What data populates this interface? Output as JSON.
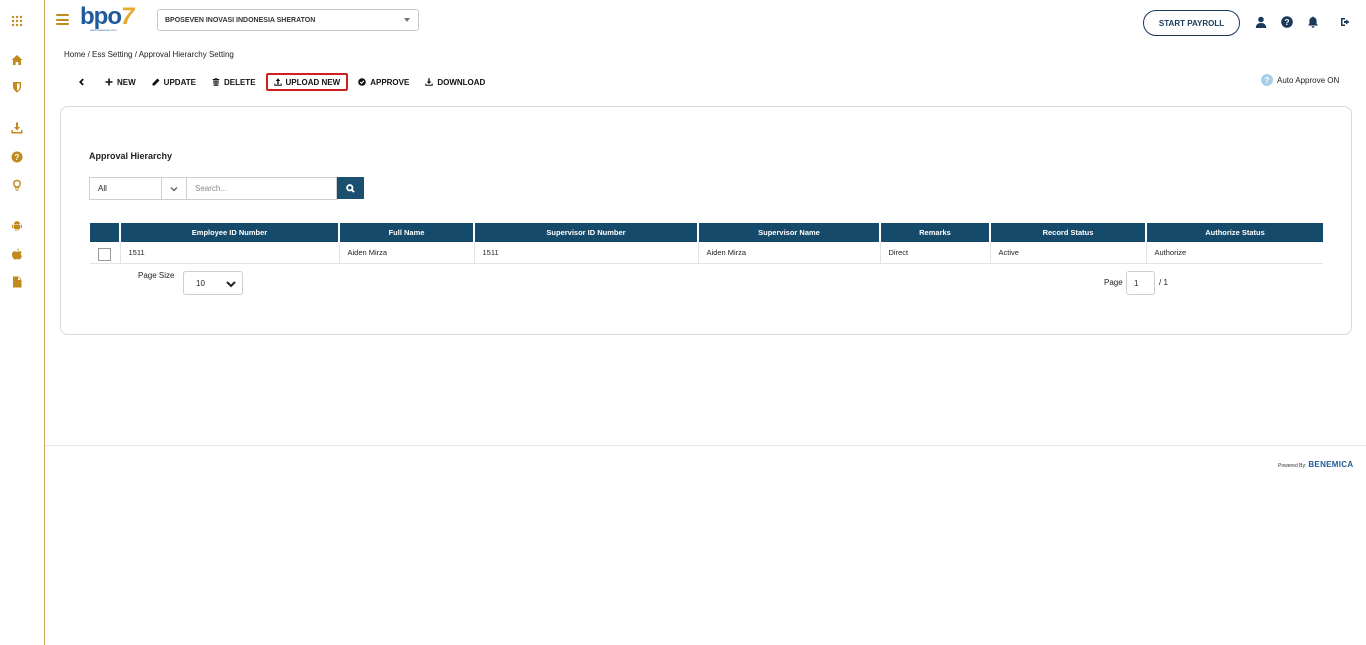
{
  "header": {
    "logo_text": "bpo",
    "logo_seven": "7",
    "logo_sub": "www.bposeven.com",
    "company": "BPOSEVEN INOVASI INDONESIA SHERATON",
    "start_payroll": "START PAYROLL"
  },
  "sidebar": {
    "icons": [
      "apps-icon",
      "home-icon",
      "shield-icon",
      "download-icon",
      "help-icon",
      "lightbulb-icon",
      "android-icon",
      "apple-icon",
      "file-icon"
    ]
  },
  "top_icons": [
    "user-icon",
    "help-icon",
    "bell-icon",
    "logout-icon"
  ],
  "breadcrumb": "Home / Ess Setting / Approval Hierarchy Setting",
  "toolbar": {
    "new": "NEW",
    "update": "UPDATE",
    "delete": "DELETE",
    "upload_new": "UPLOAD NEW",
    "approve": "APPROVE",
    "download": "DOWNLOAD"
  },
  "auto_approve": {
    "icon": "?",
    "label": "Auto Approve ON"
  },
  "card": {
    "title": "Approval Hierarchy",
    "filter_value": "All",
    "search_placeholder": "Search..."
  },
  "table": {
    "columns": [
      "Employee ID Number",
      "Full Name",
      "Supervisor ID Number",
      "Supervisor Name",
      "Remarks",
      "Record Status",
      "Authorize Status"
    ],
    "rows": [
      [
        "1511",
        "Aiden Mirza",
        "1511",
        "Aiden Mirza",
        "Direct",
        "Active",
        "Authorize"
      ]
    ]
  },
  "pagination": {
    "page_size_label": "Page Size",
    "page_size": "10",
    "page_label": "Page",
    "page": "1",
    "total": "/ 1"
  },
  "footer": {
    "powered_by": "Powered By:",
    "brand": "BENEMICA"
  },
  "colors": {
    "accent": "#c08a1e",
    "header_dark": "#164a6b",
    "highlight_border": "#d01f1f"
  }
}
